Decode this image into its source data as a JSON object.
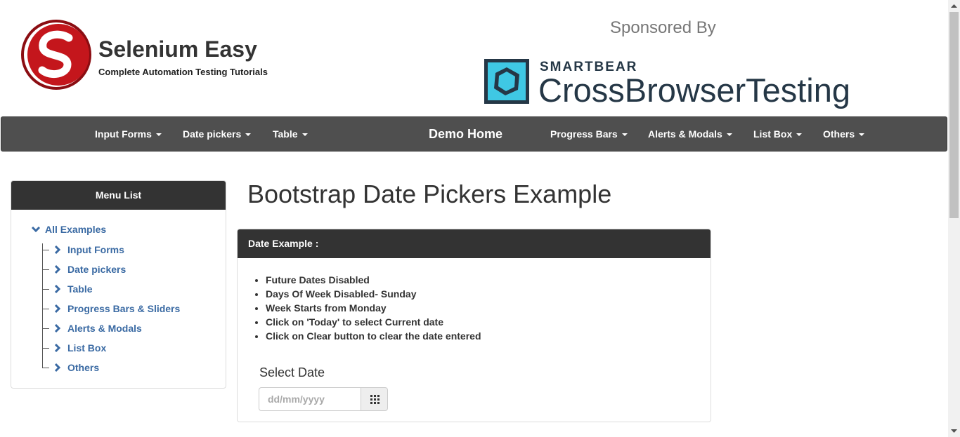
{
  "header": {
    "brand_title": "Selenium Easy",
    "brand_subtitle": "Complete Automation Testing Tutorials",
    "sponsored_label": "Sponsored By",
    "sponsor_small": "SMARTBEAR",
    "sponsor_big": "CrossBrowserTesting"
  },
  "navbar": {
    "items": [
      {
        "label": "Input Forms"
      },
      {
        "label": "Date pickers"
      },
      {
        "label": "Table"
      },
      {
        "label": "Demo Home"
      },
      {
        "label": "Progress Bars"
      },
      {
        "label": "Alerts & Modals"
      },
      {
        "label": "List Box"
      },
      {
        "label": "Others"
      }
    ]
  },
  "sidebar": {
    "heading": "Menu List",
    "root": "All Examples",
    "items": [
      {
        "label": "Input Forms"
      },
      {
        "label": "Date pickers"
      },
      {
        "label": "Table"
      },
      {
        "label": "Progress Bars & Sliders"
      },
      {
        "label": "Alerts & Modals"
      },
      {
        "label": "List Box"
      },
      {
        "label": "Others"
      }
    ]
  },
  "main": {
    "title": "Bootstrap Date Pickers Example",
    "panel_heading": "Date Example :",
    "features": [
      "Future Dates Disabled",
      "Days Of Week Disabled- Sunday",
      "Week Starts from Monday",
      "Click on 'Today' to select Current date",
      "Click on Clear button to clear the date entered"
    ],
    "select_label": "Select Date",
    "date_placeholder": "dd/mm/yyyy"
  },
  "colors": {
    "navbar_bg": "#4f4f4f",
    "panel_heading_bg": "#333333",
    "link": "#3a6aa3",
    "brand_red": "#c4161c",
    "sponsor_navy": "#253746",
    "sponsor_cyan": "#3fc8e4"
  },
  "icons": {
    "logo": "selenium-easy-logo",
    "sponsor_logo": "crossbrowsertesting-logo",
    "calendar": "grid-icon",
    "tree_root": "chevron-down-icon",
    "tree_child": "chevron-right-icon"
  }
}
